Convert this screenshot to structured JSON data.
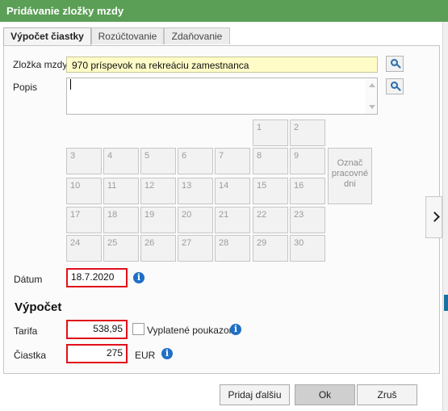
{
  "window": {
    "title": "Pridávanie zložky mzdy"
  },
  "tabs": [
    {
      "label": "Výpočet čiastky",
      "active": true
    },
    {
      "label": "Rozúčtovanie",
      "active": false
    },
    {
      "label": "Zdaňovanie",
      "active": false
    }
  ],
  "form": {
    "zlozka_label": "Zložka mzdy",
    "zlozka_value": "970  príspevok na rekreáciu zamestnanca",
    "popis_label": "Popis",
    "popis_value": "",
    "datum_label": "Dátum",
    "datum_value": "18.7.2020"
  },
  "calendar": {
    "days": [
      "1",
      "2",
      "3",
      "4",
      "5",
      "6",
      "7",
      "8",
      "9",
      "10",
      "11",
      "12",
      "13",
      "14",
      "15",
      "16",
      "17",
      "18",
      "19",
      "20",
      "21",
      "22",
      "23",
      "24",
      "25",
      "26",
      "27",
      "28",
      "29",
      "30"
    ],
    "mark_button_label": "Označ pracovné dni"
  },
  "vypocet": {
    "heading": "Výpočet",
    "tarifa_label": "Tarifa",
    "tarifa_value": "538,95",
    "poukazom_label": "Vyplatené poukazom",
    "poukazom_checked": false,
    "ciastka_label": "Čiastka",
    "ciastka_value": "275",
    "currency": "EUR"
  },
  "buttons": {
    "pridaj": "Pridaj ďalšiu",
    "ok": "Ok",
    "zrus": "Zruš"
  },
  "icons": {
    "info": "info-icon",
    "lookup": "search-lookup-icon",
    "expand": "chevron-right-icon"
  },
  "colors": {
    "title_bar": "#5a9f55",
    "highlight": "#e0101a",
    "info": "#1f6fc6",
    "yellow_field": "#fffcc7"
  }
}
